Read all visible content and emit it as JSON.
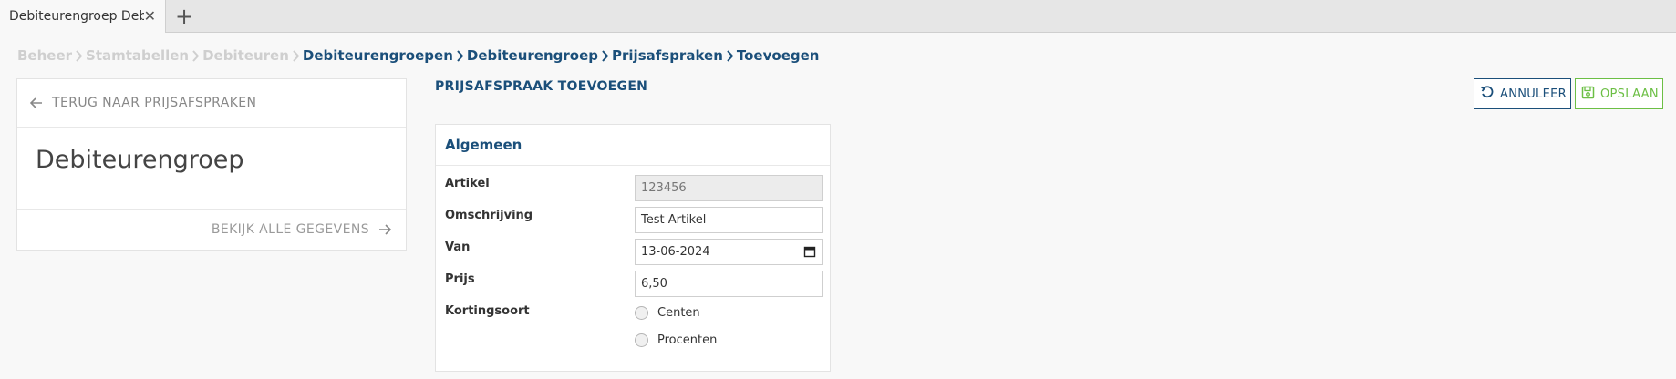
{
  "tab": {
    "title": "Debiteurengroep Debi...",
    "close_glyph": "✕",
    "add_glyph": "+"
  },
  "breadcrumb": [
    {
      "label": "Beheer",
      "active": false
    },
    {
      "label": "Stamtabellen",
      "active": false
    },
    {
      "label": "Debiteuren",
      "active": false
    },
    {
      "label": "Debiteurengroepen",
      "active": true
    },
    {
      "label": "Debiteurengroep",
      "active": true
    },
    {
      "label": "Prijsafspraken",
      "active": true
    },
    {
      "label": "Toevoegen",
      "active": true
    }
  ],
  "left_panel": {
    "back_label": "TERUG NAAR PRIJSAFSPRAKEN",
    "title": "Debiteurengroep",
    "view_all_label": "BEKIJK ALLE GEGEVENS"
  },
  "section_title": "PRIJSAFSPRAAK TOEVOEGEN",
  "actions": {
    "cancel_label": "ANNULEER",
    "save_label": "OPSLAAN"
  },
  "form": {
    "header": "Algemeen",
    "fields": {
      "artikel": {
        "label": "Artikel",
        "value": "123456"
      },
      "omschrijving": {
        "label": "Omschrijving",
        "value": "Test Artikel"
      },
      "van": {
        "label": "Van",
        "value": "13-06-2024"
      },
      "prijs": {
        "label": "Prijs",
        "value": "6,50"
      },
      "kortingsoort": {
        "label": "Kortingsoort",
        "options": [
          "Centen",
          "Procenten"
        ]
      }
    }
  },
  "colors": {
    "primary": "#1b4f7a",
    "save": "#6cbf45",
    "muted": "#cfcfcf"
  },
  "icons": [
    "close-icon",
    "plus-icon",
    "chevron-right-icon",
    "arrow-left-icon",
    "arrow-right-icon",
    "undo-icon",
    "floppy-disk-icon",
    "calendar-icon"
  ]
}
